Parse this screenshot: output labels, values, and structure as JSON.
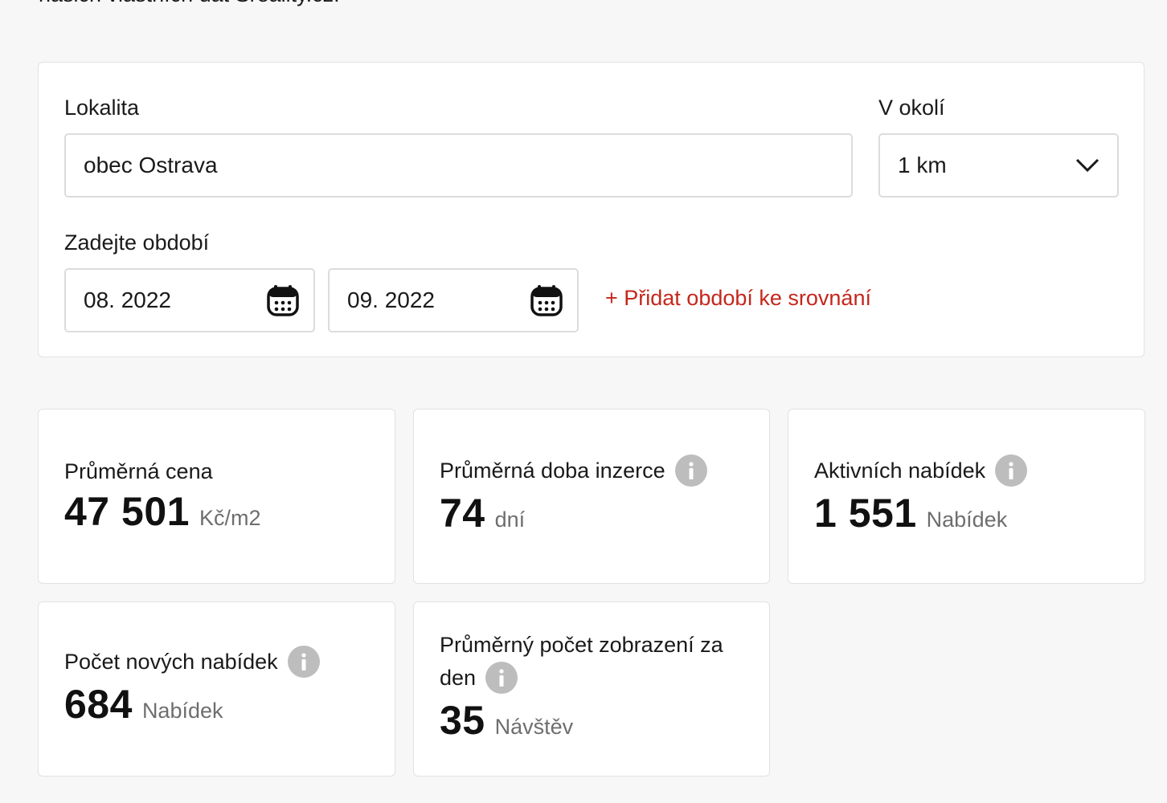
{
  "intro_text": "našich vlastních dat Sreality.cz.",
  "filters": {
    "location_label": "Lokalita",
    "location_value": "obec Ostrava",
    "radius_label": "V okolí",
    "radius_value": "1 km",
    "period_label": "Zadejte období",
    "period_from": "08. 2022",
    "period_to": "09. 2022",
    "add_period_link": "+ Přidat období ke srovnání"
  },
  "stats": [
    {
      "label": "Průměrná cena",
      "value": "47 501",
      "unit": "Kč/m2",
      "has_info": false
    },
    {
      "label": "Průměrná doba inzerce",
      "value": "74",
      "unit": "dní",
      "has_info": true
    },
    {
      "label": "Aktivních nabídek",
      "value": "1 551",
      "unit": "Nabídek",
      "has_info": true
    },
    {
      "label": "Počet nových nabídek",
      "value": "684",
      "unit": "Nabídek",
      "has_info": true
    },
    {
      "label": "Průměrný počet zobrazení za den",
      "value": "35",
      "unit": "Návštěv",
      "has_info": true
    }
  ],
  "icons": {
    "info": "i",
    "chevron": "chevron-down-icon",
    "calendar": "calendar-icon"
  },
  "colors": {
    "accent_red": "#c4271c",
    "info_gray": "#bdbdbd",
    "background": "#f7f7f7"
  }
}
